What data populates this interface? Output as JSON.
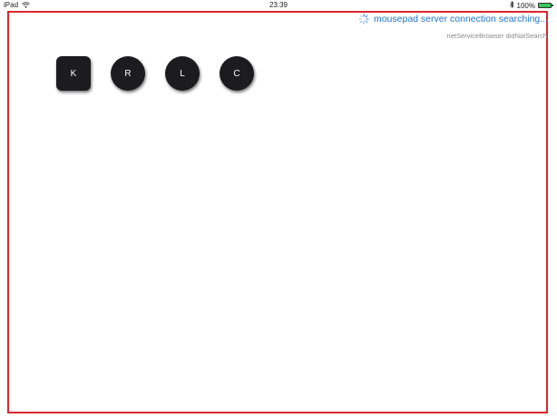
{
  "status_bar": {
    "device": "iPad",
    "time": "23:39",
    "battery": "100%",
    "battery_color": "#34c759",
    "icons": [
      "wifi-icon",
      "bluetooth-icon",
      "battery-icon"
    ]
  },
  "connection": {
    "status_text": "mousepad server connection searching...",
    "detail_text": "netServiceBrowser didNotSearch",
    "status_color": "#1d76d2",
    "icon": "spinner-icon"
  },
  "buttons": {
    "k_label": "K",
    "r_label": "R",
    "l_label": "L",
    "c_label": "C"
  },
  "colors": {
    "frame_border": "#d9272e",
    "button_bg": "#1c1c1e"
  }
}
